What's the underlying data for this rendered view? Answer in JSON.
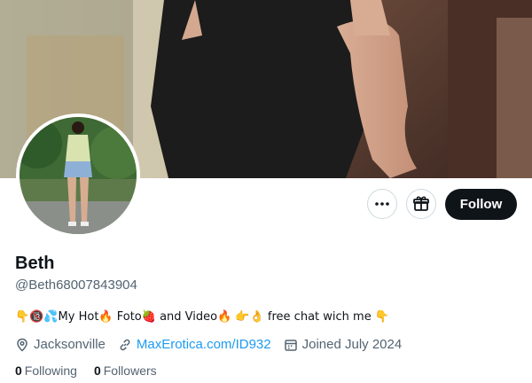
{
  "profile": {
    "display_name": "Beth",
    "handle": "@Beth68007843904",
    "bio": "👇🔞💦My Hot🔥 Foto🍓 and Video🔥 👉👌 free chat wich me 👇",
    "location": "Jacksonville",
    "website": "MaxErotica.com/ID932",
    "joined": "Joined July 2024"
  },
  "stats": {
    "following_count": "0",
    "following_label": "Following",
    "followers_count": "0",
    "followers_label": "Followers"
  },
  "actions": {
    "follow_label": "Follow",
    "more_icon": "more-dots-icon",
    "subscribe_icon": "gift-icon"
  },
  "colors": {
    "accent": "#1d9bf0",
    "button_dark": "#0f1419",
    "secondary_text": "#536471"
  }
}
